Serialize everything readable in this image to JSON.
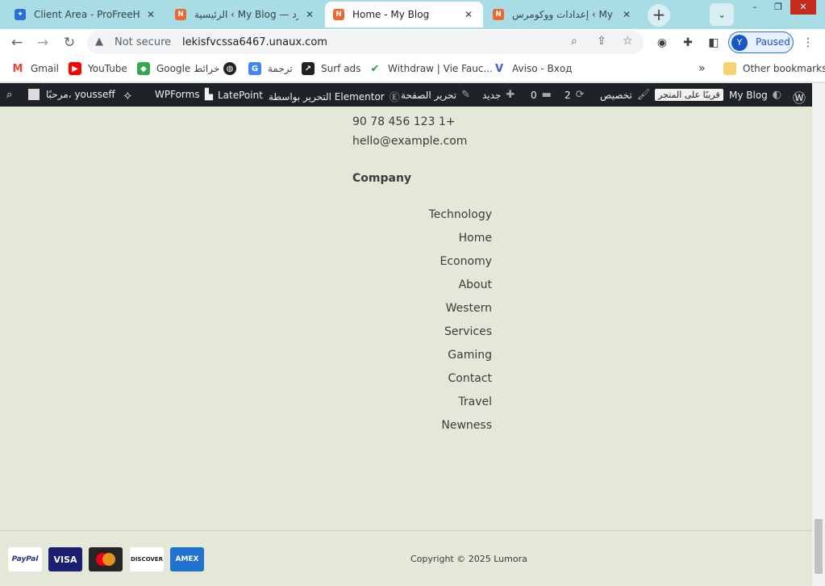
{
  "tabs": [
    {
      "title": "Client Area - ProFreeHost",
      "favicon": "profreehost-icon"
    },
    {
      "title": "الرئيسية ‹ My Blog — وورد",
      "favicon": "wp-n-icon"
    },
    {
      "title": "Home - My Blog",
      "favicon": "wp-n-icon"
    },
    {
      "title": "إعدادات ووكومرس ‹ My Blog",
      "favicon": "wp-n-icon"
    }
  ],
  "window": {
    "minimize": "–",
    "restore": "❐",
    "close": "✕",
    "tab_search": "⌄",
    "new_tab": "+"
  },
  "address": {
    "security_label": "Not secure",
    "url": "lekisfvcssa6467.unaux.com"
  },
  "profile": {
    "initial": "Y",
    "status": "Paused"
  },
  "bookmarks": [
    {
      "label": "Gmail"
    },
    {
      "label": "YouTube"
    },
    {
      "label": "Google خرائط"
    },
    {
      "label": ""
    },
    {
      "label": "ترجمة"
    },
    {
      "label": "Surf ads"
    },
    {
      "label": "Withdraw | Vie Fauc..."
    },
    {
      "label": "Aviso - Вход"
    }
  ],
  "bookmarks_more": "»",
  "other_bookmarks": "Other bookmarks",
  "adminbar": {
    "greeting": "مرحبًا، yousseff",
    "wpforms": "WPForms",
    "latepoint": "LatePoint",
    "elementor": "التحرير بواسطة Elementor",
    "edit_page": "تحرير الصفحة",
    "new": "جديد",
    "comments": "0",
    "updates": "2",
    "customize": "تخصيص",
    "store": "قريبًا على المتجر",
    "site": "My Blog"
  },
  "contact": {
    "phone": "90 78 456 123 1+",
    "email": "hello@example.com"
  },
  "company": {
    "heading": "Company",
    "items": [
      "Technology",
      "Home",
      "Economy",
      "About",
      "Western",
      "Services",
      "Gaming",
      "Contact",
      "Travel",
      "Newness"
    ]
  },
  "payments": [
    {
      "name": "PayPal",
      "label": "PayPal"
    },
    {
      "name": "Visa",
      "label": "VISA"
    },
    {
      "name": "Mastercard",
      "label": ""
    },
    {
      "name": "Discover",
      "label": "DISCOVER"
    },
    {
      "name": "Amex",
      "label": "AMEX"
    }
  ],
  "copyright": "Copyright © 2025 Lumora",
  "colors": {
    "page_bg": "#e4e8d9",
    "admin_bar": "#1d2327",
    "tab_strip": "#a8dde6",
    "accent": "#1a73e8"
  }
}
